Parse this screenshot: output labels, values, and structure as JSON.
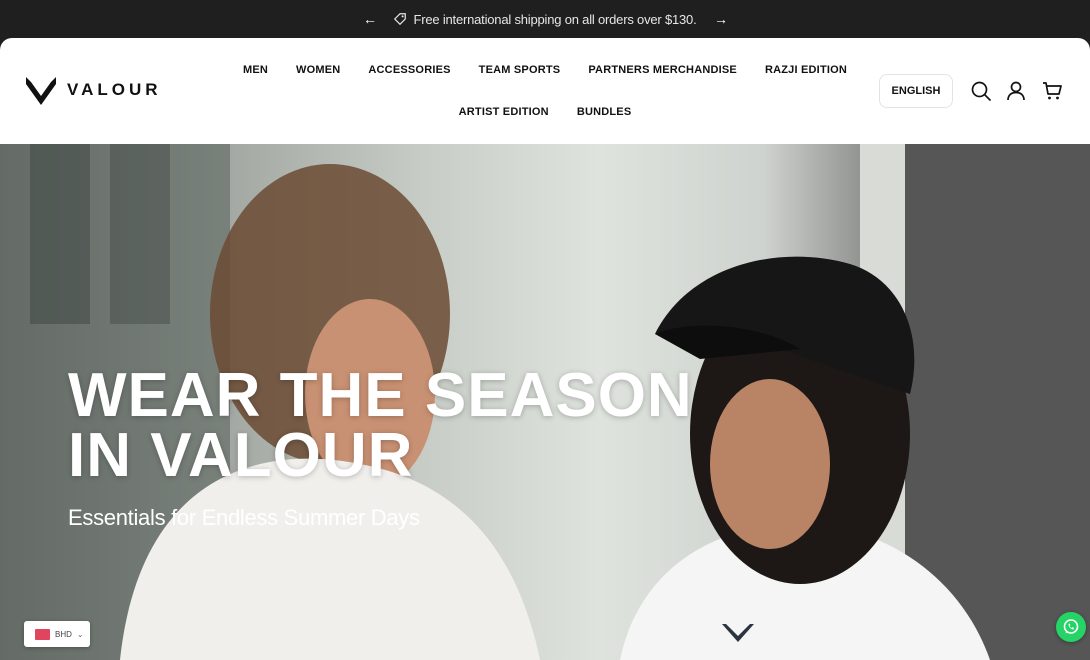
{
  "announcement": {
    "prev_icon": "arrow-left-icon",
    "next_icon": "arrow-right-icon",
    "icon": "shipping-tag-icon",
    "text": "Free international shipping on all orders over $130."
  },
  "header": {
    "logo_text": "VALOUR",
    "nav": [
      "MEN",
      "WOMEN",
      "ACCESSORIES",
      "TEAM SPORTS",
      "PARTNERS MERCHANDISE",
      "RAZJI EDITION",
      "ARTIST EDITION",
      "BUNDLES"
    ],
    "language": "ENGLISH",
    "icons": [
      "search-icon",
      "account-icon",
      "cart-icon"
    ]
  },
  "hero": {
    "title_line1": "WEAR THE SEASON",
    "title_line2": "IN VALOUR",
    "subtitle": "Essentials for Endless Summer Days"
  },
  "currency": {
    "code": "BHD",
    "flag_color": "#e0445e"
  },
  "colors": {
    "announcement_bg": "#1f1f1f",
    "whatsapp": "#25d366"
  }
}
